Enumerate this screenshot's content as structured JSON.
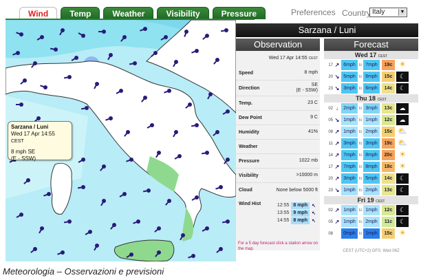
{
  "tabs": [
    {
      "label": "Wind",
      "active": true
    },
    {
      "label": "Temp",
      "active": false
    },
    {
      "label": "Weather",
      "active": false
    },
    {
      "label": "Visibility",
      "active": false
    },
    {
      "label": "Pressure",
      "active": false
    }
  ],
  "preferences_link": "Preferences",
  "country_label": "Country",
  "country_value": "Italy",
  "station_title": "Sarzana / Luni",
  "popup": {
    "station": "Sarzana / Luni",
    "time": "Wed 17 Apr 14:55",
    "tz": "CEST",
    "wind": "8 mph SE",
    "dir_full": "(E - SSW)"
  },
  "observation": {
    "heading": "Observation",
    "date": "Wed 17 Apr 14:55",
    "tz": "CEST",
    "speed_label": "Speed",
    "speed": "8 mph",
    "direction_label": "Direction",
    "direction": "SE",
    "direction_range": "(E - SSW)",
    "temp_label": "Temp.",
    "temp": "23 C",
    "dew_label": "Dew Point",
    "dew": "9 C",
    "humidity_label": "Humidity",
    "humidity": "41%",
    "weather_label": "Weather",
    "weather": "",
    "pressure_label": "Pressure",
    "pressure": "1022 mb",
    "visibility_label": "Visibility",
    "visibility": ">10000 m",
    "cloud_label": "Cloud",
    "cloud": "None below 5000 ft",
    "windhist_label": "Wind Hist",
    "windhist": [
      {
        "time": "12:55",
        "speed": "8 mph",
        "dir": "↖"
      },
      {
        "time": "13:55",
        "speed": "9 mph",
        "dir": "↖"
      },
      {
        "time": "14:55",
        "speed": "8 mph",
        "dir": "↖"
      }
    ],
    "note": "For a 5 day forecast click a station arrow on the map."
  },
  "forecast": {
    "heading": "Forecast",
    "to_word": "to",
    "days": [
      {
        "label": "Wed 17",
        "tz": "CEST",
        "rows": [
          {
            "hour": "17",
            "dir": "↗",
            "wmin": "6mph",
            "wmax": "7mph",
            "temp": "19c",
            "icon": "sun",
            "glyph": "☀",
            "temp_color": "#f7a25a",
            "ws_color": "#4fc6f2"
          },
          {
            "hour": "20",
            "dir": "↘",
            "wmin": "5mph",
            "wmax": "6mph",
            "temp": "15c",
            "icon": "night",
            "glyph": "☾",
            "temp_color": "#f3ce72",
            "ws_color": "#4fc6f2"
          },
          {
            "hour": "23",
            "dir": "↘",
            "wmin": "3mph",
            "wmax": "6mph",
            "temp": "14c",
            "icon": "night",
            "glyph": "☾",
            "temp_color": "#efe08a",
            "ws_color": "#4fc6f2"
          }
        ]
      },
      {
        "label": "Thu 18",
        "tz": "CEST",
        "rows": [
          {
            "hour": "02",
            "dir": "↓",
            "wmin": "2mph",
            "wmax": "3mph",
            "temp": "13c",
            "icon": "cloud",
            "glyph": "☁",
            "temp_color": "#e6e68e",
            "ws_color": "#7fd7f6"
          },
          {
            "hour": "05",
            "dir": "↘",
            "wmin": "1mph",
            "wmax": "1mph",
            "temp": "12c",
            "icon": "cloud",
            "glyph": "☁",
            "temp_color": "#d8e892",
            "ws_color": "#a9e2fa"
          },
          {
            "hour": "08",
            "dir": "↗",
            "wmin": "1mph",
            "wmax": "2mph",
            "temp": "15c",
            "icon": "suncloud",
            "glyph": "⛅",
            "temp_color": "#f3ce72",
            "ws_color": "#a9e2fa"
          },
          {
            "hour": "11",
            "dir": "↗",
            "wmin": "3mph",
            "wmax": "3mph",
            "temp": "19c",
            "icon": "suncloud",
            "glyph": "⛅",
            "temp_color": "#f7a25a",
            "ws_color": "#4fc6f2"
          },
          {
            "hour": "14",
            "dir": "↗",
            "wmin": "7mph",
            "wmax": "8mph",
            "temp": "20c",
            "icon": "sun",
            "glyph": "☀",
            "temp_color": "#f7a25a",
            "ws_color": "#4fc6f2"
          },
          {
            "hour": "17",
            "dir": "↗",
            "wmin": "7mph",
            "wmax": "8mph",
            "temp": "18c",
            "icon": "sun",
            "glyph": "☀",
            "temp_color": "#f5b866",
            "ws_color": "#4fc6f2"
          },
          {
            "hour": "20",
            "dir": "↗",
            "wmin": "3mph",
            "wmax": "5mph",
            "temp": "14c",
            "icon": "night",
            "glyph": "☾",
            "temp_color": "#efe08a",
            "ws_color": "#4fc6f2"
          },
          {
            "hour": "23",
            "dir": "↘",
            "wmin": "1mph",
            "wmax": "2mph",
            "temp": "13c",
            "icon": "night",
            "glyph": "☾",
            "temp_color": "#e6e68e",
            "ws_color": "#a9e2fa"
          }
        ]
      },
      {
        "label": "Fri 19",
        "tz": "CEST",
        "rows": [
          {
            "hour": "02",
            "dir": "↗",
            "wmin": "1mph",
            "wmax": "1mph",
            "temp": "12c",
            "icon": "night",
            "glyph": "☾",
            "temp_color": "#d8e892",
            "ws_color": "#a9e2fa"
          },
          {
            "hour": "05",
            "dir": "↗",
            "wmin": "1mph",
            "wmax": "2mph",
            "temp": "11c",
            "icon": "night",
            "glyph": "☾",
            "temp_color": "#d0ea9a",
            "ws_color": "#a9e2fa"
          },
          {
            "hour": "08",
            "dir": "",
            "wmin": "0mph",
            "wmax": "1mph",
            "temp": "15c",
            "icon": "sun",
            "glyph": "☀",
            "temp_color": "#f3ce72",
            "ws_color": "#2a7de9"
          }
        ]
      }
    ],
    "footer": "CEST (UTC+2) GFS: Wed 06Z"
  },
  "caption": "Meteorologia – Osservazioni e previsioni",
  "colors": {
    "tab_green": "#2d7d2f",
    "active_tab_text": "#dd2222",
    "arrow": "#2a1b7a",
    "sea_light": "#ccf4f8",
    "sea_mid": "#8fe2f0",
    "land": "#ffffff",
    "low_wind": "#8fd98f"
  }
}
